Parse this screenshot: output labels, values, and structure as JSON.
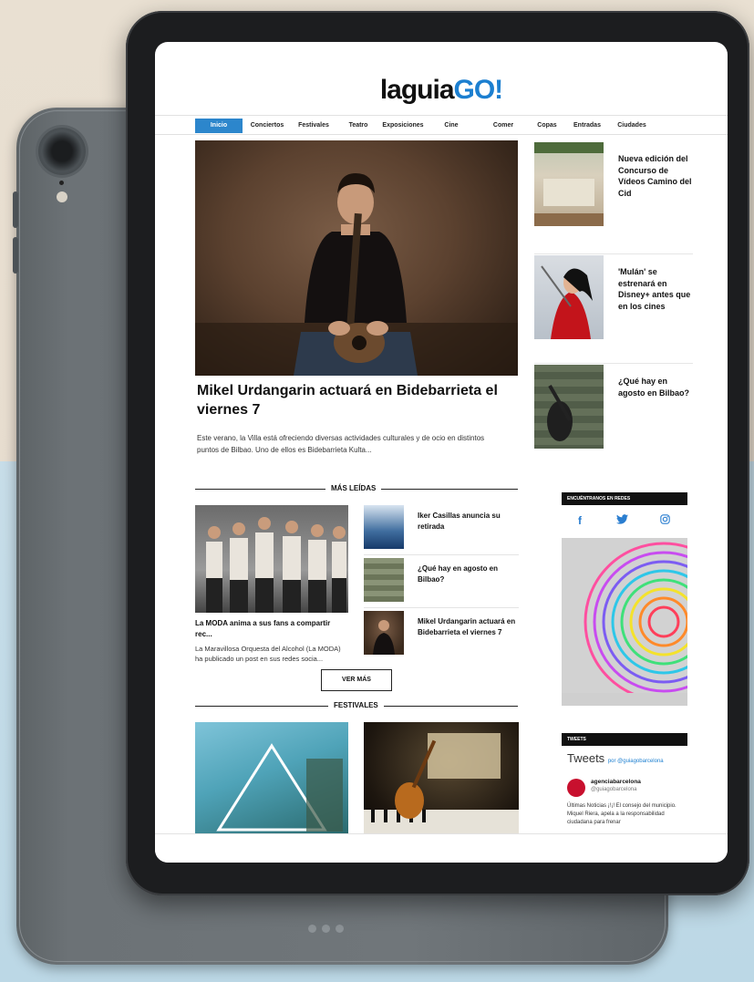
{
  "site": {
    "logo_part1": "laguia",
    "logo_part2": "GO!",
    "brand_color": "#1c7fd0"
  },
  "nav": {
    "items": [
      {
        "label": "Inicio",
        "active": true
      },
      {
        "label": "Conciertos"
      },
      {
        "label": "Festivales"
      },
      {
        "label": "Teatro"
      },
      {
        "label": "Exposiciones"
      },
      {
        "label": "Cine"
      },
      {
        "label": "Comer"
      },
      {
        "label": "Copas"
      },
      {
        "label": "Entradas"
      },
      {
        "label": "Ciudades"
      }
    ]
  },
  "hero": {
    "title": "Mikel Urdangarin actuará en Bidebarrieta el viernes 7",
    "lead": "Este verano, la Villa está ofreciendo diversas actividades culturales y de ocio en distintos puntos de Bilbao. Uno de ellos es Bidebarrieta Kulta..."
  },
  "side_news": [
    {
      "title": "Nueva edición del Concurso de Vídeos Camino del Cid"
    },
    {
      "title": "'Mulán' se estrenará en Disney+ antes que en los cines"
    },
    {
      "title": "¿Qué hay en agosto en Bilbao?"
    }
  ],
  "mas_leidas": {
    "section_title": "MÁS LEÍDAS",
    "featured_title": "La MODA anima a sus fans a compartir rec...",
    "featured_text": "La Maravillosa Orquesta del Alcohol (La MODA) ha publicado un post en sus redes socia...",
    "items": [
      {
        "title": "Iker Casillas anuncia su retirada"
      },
      {
        "title": "¿Qué hay en agosto en Bilbao?"
      },
      {
        "title": "Mikel Urdangarin actuará en Bidebarrieta el viernes 7"
      }
    ],
    "more_button": "VER MÁS"
  },
  "festivales": {
    "section_title": "FESTIVALES"
  },
  "sidebar": {
    "follow_label": "ENCUÉNTRANOS EN REDES",
    "social_icons": [
      "facebook-icon",
      "twitter-icon",
      "instagram-icon"
    ],
    "tweets_bar": "TWEETS",
    "tweets_title": "Tweets",
    "tweets_by": "por @guiagobarcelona",
    "tweet_name": "agenciabarcelona",
    "tweet_handle": "@guiagobarcelona",
    "tweet_text": "Últimas Noticias ¡!¡! El consejo del municipio. Miquel Riera, apela a la responsabilidad ciudadana para frenar"
  }
}
